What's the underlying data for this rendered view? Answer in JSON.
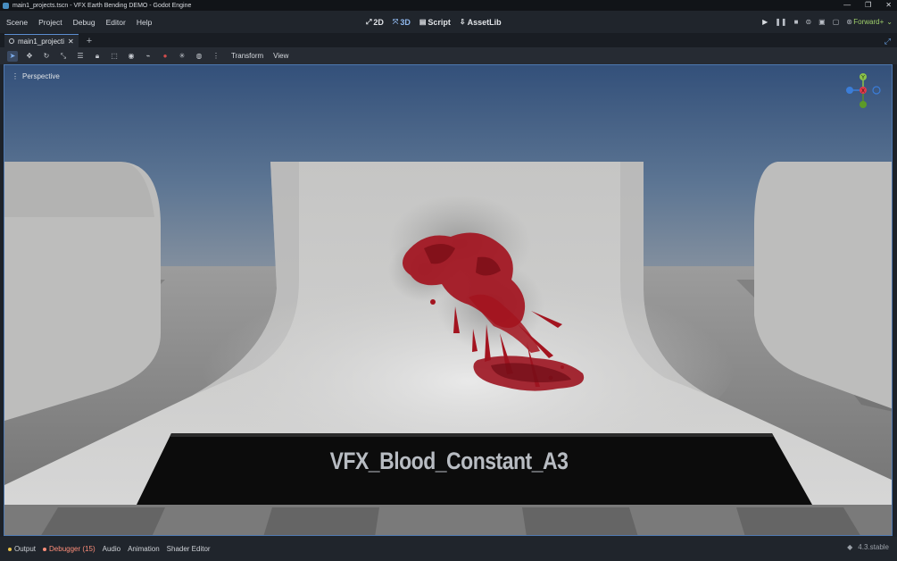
{
  "window": {
    "title": "main1_projects.tscn - VFX Earth Bending DEMO - Godot Engine",
    "controls": [
      "—",
      "❐",
      "✕"
    ]
  },
  "menus": [
    "Scene",
    "Project",
    "Debug",
    "Editor",
    "Help"
  ],
  "workspaces": [
    {
      "label": "2D",
      "icon": "2d-icon",
      "active": false
    },
    {
      "label": "3D",
      "icon": "3d-icon",
      "active": true
    },
    {
      "label": "Script",
      "icon": "script-icon",
      "active": false
    },
    {
      "label": "AssetLib",
      "icon": "assetlib-icon",
      "active": false
    }
  ],
  "renderer": {
    "label": "Forward+",
    "color": "#9fcf6b"
  },
  "tab": {
    "label": "main1_projecti"
  },
  "toolbar": {
    "transform_menu": "Transform",
    "view_menu": "View"
  },
  "viewport": {
    "perspective_label": "Perspective",
    "banner_text": "VFX_Blood_Constant_A3",
    "gizmo_labels": {
      "y": "Y",
      "x": "X"
    }
  },
  "bottom_panels": [
    {
      "label": "Output",
      "bullet": "#e8c14a",
      "warn": false
    },
    {
      "label": "Debugger (15)",
      "bullet": "#ff8e7a",
      "warn": true
    },
    {
      "label": "Audio",
      "bullet": null,
      "warn": false
    },
    {
      "label": "Animation",
      "bullet": null,
      "warn": false
    },
    {
      "label": "Shader Editor",
      "bullet": null,
      "warn": false
    }
  ],
  "version": "4.3.stable",
  "colors": {
    "accent": "#478cbf",
    "selection": "#4d78b0",
    "warning": "#ff8e7a",
    "blood": "#a3141f"
  }
}
